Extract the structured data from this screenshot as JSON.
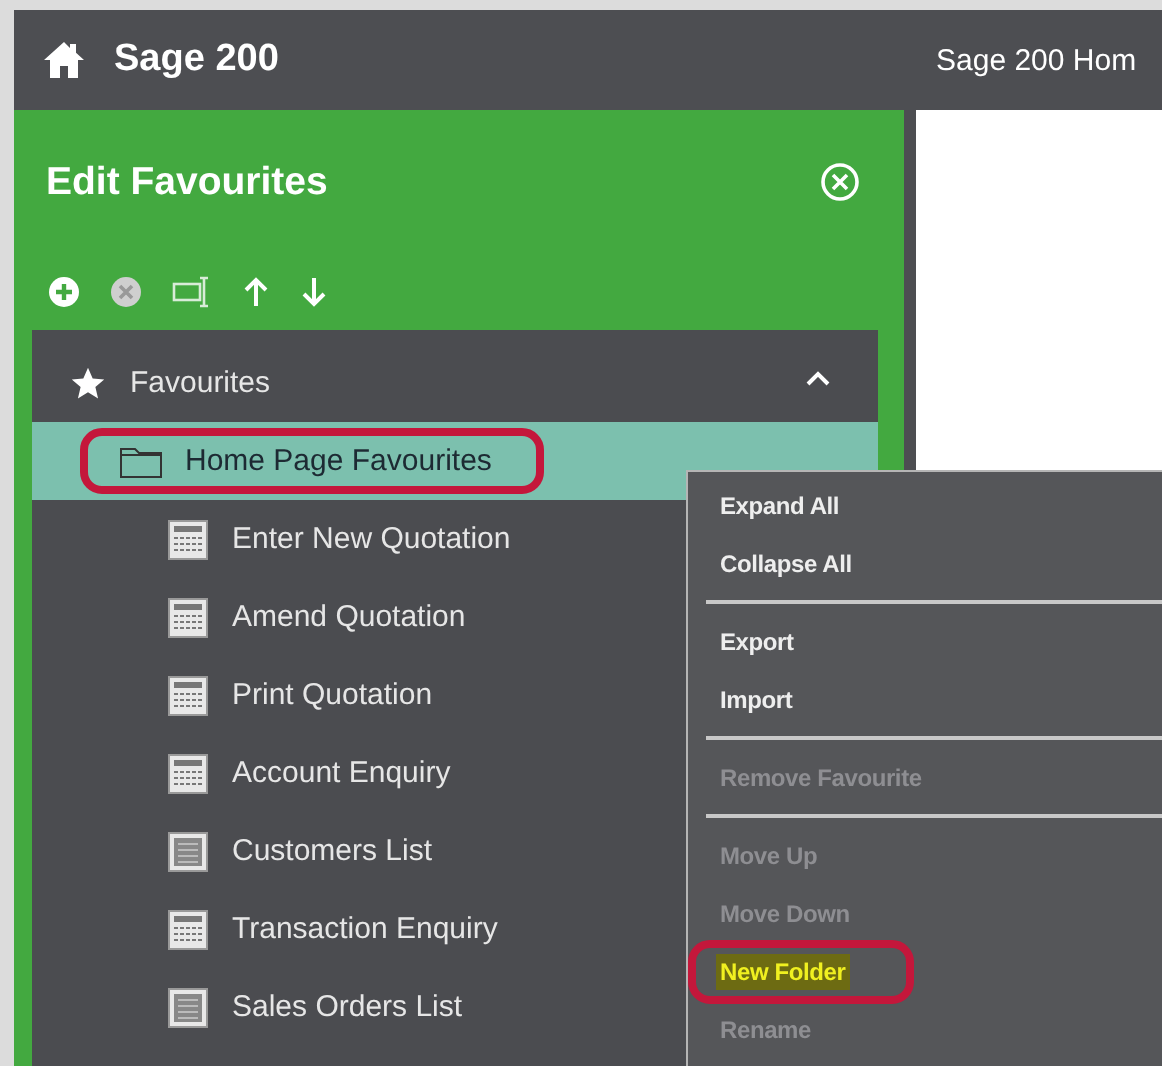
{
  "top_bar": {
    "app_title": "Sage 200",
    "page_title": "Sage 200 Hom"
  },
  "panel": {
    "title": "Edit Favourites"
  },
  "tree": [
    {
      "label": "Favourites",
      "kind": "star",
      "expanded": true,
      "selected": false,
      "annotated": false,
      "children": [
        {
          "label": "Home Page Favourites",
          "kind": "folder",
          "selected": true,
          "annotated": true,
          "children": [
            {
              "label": "Enter New Quotation",
              "kind": "form",
              "selected": false,
              "annotated": false
            },
            {
              "label": "Amend Quotation",
              "kind": "form",
              "selected": false,
              "annotated": false
            },
            {
              "label": "Print Quotation",
              "kind": "form",
              "selected": false,
              "annotated": false
            },
            {
              "label": "Account Enquiry",
              "kind": "form",
              "selected": false,
              "annotated": false
            },
            {
              "label": "Customers List",
              "kind": "list",
              "selected": false,
              "annotated": false
            },
            {
              "label": "Transaction Enquiry",
              "kind": "form",
              "selected": false,
              "annotated": false
            },
            {
              "label": "Sales Orders List",
              "kind": "list",
              "selected": false,
              "annotated": false
            }
          ]
        }
      ]
    }
  ],
  "context_menu": [
    {
      "kind": "item",
      "label": "Expand All",
      "disabled": false,
      "highlighted": false,
      "annotated": false
    },
    {
      "kind": "item",
      "label": "Collapse All",
      "disabled": false,
      "highlighted": false,
      "annotated": false
    },
    {
      "kind": "separator"
    },
    {
      "kind": "item",
      "label": "Export",
      "disabled": false,
      "highlighted": false,
      "annotated": false
    },
    {
      "kind": "item",
      "label": "Import",
      "disabled": false,
      "highlighted": false,
      "annotated": false
    },
    {
      "kind": "separator"
    },
    {
      "kind": "item",
      "label": "Remove Favourite",
      "disabled": true,
      "highlighted": false,
      "annotated": false
    },
    {
      "kind": "separator"
    },
    {
      "kind": "item",
      "label": "Move Up",
      "disabled": true,
      "highlighted": false,
      "annotated": false
    },
    {
      "kind": "item",
      "label": "Move Down",
      "disabled": true,
      "highlighted": false,
      "annotated": false
    },
    {
      "kind": "item",
      "label": "New Folder",
      "disabled": false,
      "highlighted": true,
      "annotated": true
    },
    {
      "kind": "item",
      "label": "Rename",
      "disabled": true,
      "highlighted": false,
      "annotated": false
    }
  ]
}
